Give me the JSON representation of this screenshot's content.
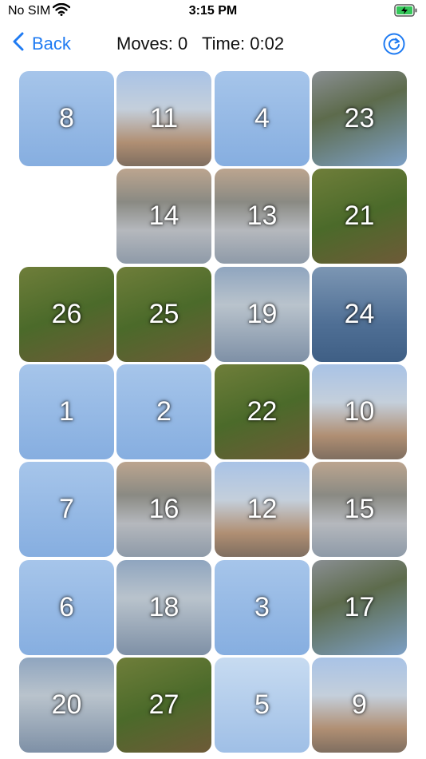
{
  "status_bar": {
    "carrier": "No SIM",
    "time": "3:15 PM"
  },
  "nav": {
    "back_label": "Back",
    "moves_label": "Moves: 0",
    "time_label": "Time: 0:02",
    "accent_color": "#1f7bf2"
  },
  "board": {
    "columns": 4,
    "rows": 7,
    "empty_position": "row 2, column 1",
    "tiles": [
      {
        "label": "8",
        "style": "sky"
      },
      {
        "label": "11",
        "style": "city"
      },
      {
        "label": "4",
        "style": "sky"
      },
      {
        "label": "23",
        "style": "shore"
      },
      {
        "label": "",
        "style": "empty"
      },
      {
        "label": "14",
        "style": "cityrefl"
      },
      {
        "label": "13",
        "style": "cityrefl"
      },
      {
        "label": "21",
        "style": "grass"
      },
      {
        "label": "26",
        "style": "grass"
      },
      {
        "label": "25",
        "style": "grass"
      },
      {
        "label": "19",
        "style": "refl"
      },
      {
        "label": "24",
        "style": "water"
      },
      {
        "label": "1",
        "style": "sky"
      },
      {
        "label": "2",
        "style": "sky"
      },
      {
        "label": "22",
        "style": "grass"
      },
      {
        "label": "10",
        "style": "city"
      },
      {
        "label": "7",
        "style": "sky"
      },
      {
        "label": "16",
        "style": "cityrefl"
      },
      {
        "label": "12",
        "style": "city"
      },
      {
        "label": "15",
        "style": "cityrefl"
      },
      {
        "label": "6",
        "style": "sky"
      },
      {
        "label": "18",
        "style": "refl"
      },
      {
        "label": "3",
        "style": "sky"
      },
      {
        "label": "17",
        "style": "shore"
      },
      {
        "label": "20",
        "style": "refl"
      },
      {
        "label": "27",
        "style": "grass"
      },
      {
        "label": "5",
        "style": "sky-pale"
      },
      {
        "label": "9",
        "style": "city"
      }
    ]
  }
}
